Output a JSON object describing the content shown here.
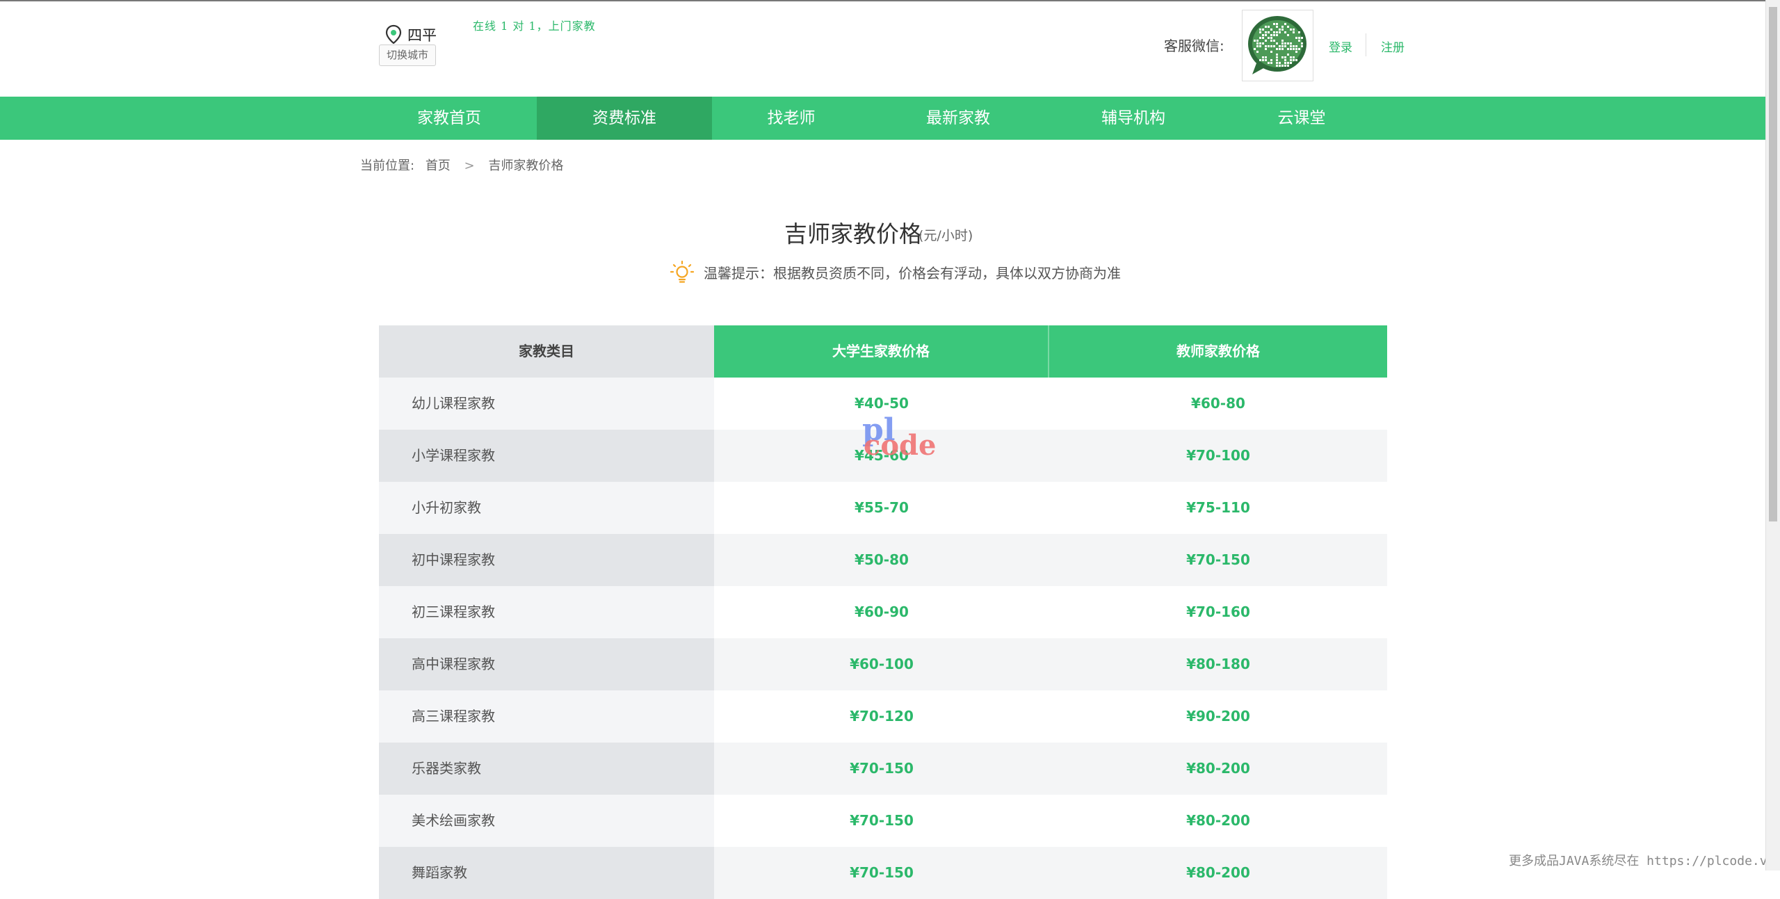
{
  "header": {
    "city": "四平",
    "switch_city": "切换城市",
    "slogan": "在线 1 对 1，上门家教",
    "wechat_label": "客服微信:",
    "login": "登录",
    "register": "注册"
  },
  "nav": {
    "items": [
      {
        "label": "家教首页",
        "active": false
      },
      {
        "label": "资费标准",
        "active": true
      },
      {
        "label": "找老师",
        "active": false
      },
      {
        "label": "最新家教",
        "active": false
      },
      {
        "label": "辅导机构",
        "active": false
      },
      {
        "label": "云课堂",
        "active": false
      }
    ]
  },
  "breadcrumb": {
    "prefix": "当前位置:",
    "home": "首页",
    "separator": ">",
    "current": "吉师家教价格"
  },
  "page": {
    "title": "吉师家教价格",
    "unit": "(元/小时)",
    "tip": "温馨提示：根据教员资质不同，价格会有浮动，具体以双方协商为准"
  },
  "table": {
    "headers": [
      "家教类目",
      "大学生家教价格",
      "教师家教价格"
    ],
    "rows": [
      {
        "category": "幼儿课程家教",
        "student": "¥40-50",
        "teacher": "¥60-80"
      },
      {
        "category": "小学课程家教",
        "student": "¥45-60",
        "teacher": "¥70-100"
      },
      {
        "category": "小升初家教",
        "student": "¥55-70",
        "teacher": "¥75-110"
      },
      {
        "category": "初中课程家教",
        "student": "¥50-80",
        "teacher": "¥70-150"
      },
      {
        "category": "初三课程家教",
        "student": "¥60-90",
        "teacher": "¥70-160"
      },
      {
        "category": "高中课程家教",
        "student": "¥60-100",
        "teacher": "¥80-180"
      },
      {
        "category": "高三课程家教",
        "student": "¥70-120",
        "teacher": "¥90-200"
      },
      {
        "category": "乐器类家教",
        "student": "¥70-150",
        "teacher": "¥80-200"
      },
      {
        "category": "美术绘画家教",
        "student": "¥70-150",
        "teacher": "¥80-200"
      },
      {
        "category": "舞蹈家教",
        "student": "¥70-150",
        "teacher": "¥80-200"
      }
    ]
  },
  "watermark": {
    "pl": "pl",
    "code": "code"
  },
  "footer_note": "更多成品JAVA系统尽在 https://plcode.vip",
  "colors": {
    "brand_green": "#3bc77b",
    "active_green": "#2fa862",
    "price_green": "#2bb86a",
    "tip_orange": "#f5a623"
  },
  "icons": {
    "location": "location-pin-icon",
    "tip": "lightbulb-icon",
    "qr": "wechat-qr-code"
  }
}
